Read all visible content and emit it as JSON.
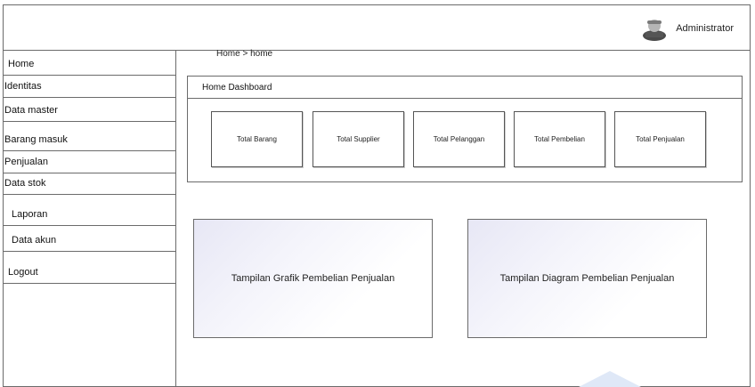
{
  "header": {
    "user_name": "Administrator",
    "user_icon": "user-icon"
  },
  "sidebar": {
    "items": [
      {
        "label": "Home"
      },
      {
        "label": "Identitas"
      },
      {
        "label": "Data master"
      },
      {
        "label": "Barang masuk"
      },
      {
        "label": "Penjualan"
      },
      {
        "label": "Data stok"
      },
      {
        "label": "Laporan"
      },
      {
        "label": "Data akun"
      },
      {
        "label": "Logout"
      }
    ]
  },
  "breadcrumb": "Home > home",
  "dashboard": {
    "title": "Home Dashboard",
    "cards": [
      {
        "label": "Total Barang"
      },
      {
        "label": "Total Supplier"
      },
      {
        "label": "Total Pelanggan"
      },
      {
        "label": "Total Pembelian"
      },
      {
        "label": "Total Penjualan"
      }
    ]
  },
  "panels": {
    "chart": "Tampilan Grafik Pembelian Penjualan",
    "diagram": "Tampilan Diagram Pembelian Penjualan"
  }
}
